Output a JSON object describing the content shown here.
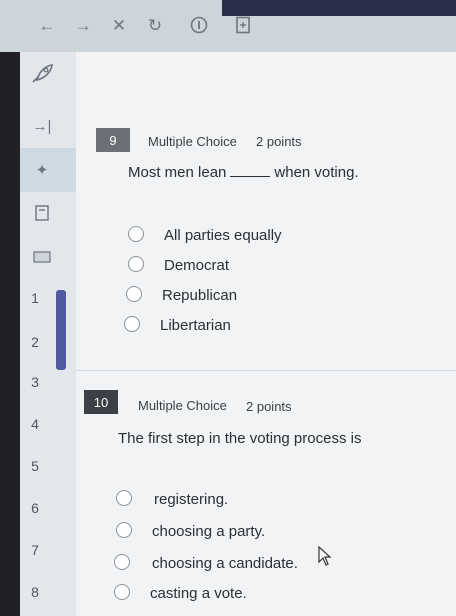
{
  "toolbar": {
    "icons": [
      "back-arrow-icon",
      "forward-arrow-icon",
      "close-icon",
      "refresh-icon",
      "info-icon",
      "document-icon"
    ]
  },
  "sidebar": {
    "icons": [
      "rocket-icon",
      "collapse-arrow-icon",
      "pin-icon",
      "calculator-icon",
      "keyboard-icon"
    ],
    "numbers": [
      "1",
      "2",
      "3",
      "4",
      "5",
      "6",
      "7",
      "8"
    ]
  },
  "questions": [
    {
      "number": "9",
      "type": "Multiple Choice",
      "points": "2 points",
      "text_before": "Most men lean",
      "text_after": "when voting.",
      "options": [
        "All parties equally",
        "Democrat",
        "Republican",
        "Libertarian"
      ]
    },
    {
      "number": "10",
      "type": "Multiple Choice",
      "points": "2 points",
      "text": "The first step in the voting process is",
      "options": [
        "registering.",
        "choosing a party.",
        "choosing a candidate.",
        "casting a vote."
      ]
    }
  ],
  "colors": {
    "badge": "#6b6f76",
    "badge_active": "#3b3f46",
    "scrollbar": "#4f5aa0"
  }
}
